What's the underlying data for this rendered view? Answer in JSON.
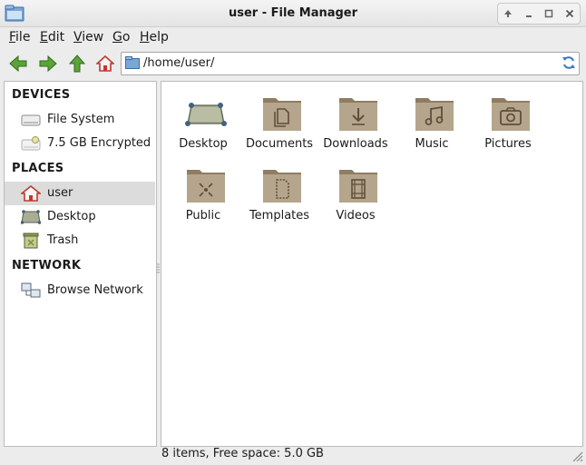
{
  "window": {
    "title": "user - File Manager"
  },
  "menu": [
    {
      "label": "File",
      "u": "F",
      "rest": "ile"
    },
    {
      "label": "Edit",
      "u": "E",
      "rest": "dit"
    },
    {
      "label": "View",
      "u": "V",
      "rest": "iew"
    },
    {
      "label": "Go",
      "u": "G",
      "rest": "o"
    },
    {
      "label": "Help",
      "u": "H",
      "rest": "elp"
    }
  ],
  "location": {
    "path": "/home/user/"
  },
  "sidebar": {
    "devices_header": "DEVICES",
    "places_header": "PLACES",
    "network_header": "NETWORK",
    "devices": [
      {
        "label": "File System",
        "icon": "drive-icon"
      },
      {
        "label": "7.5 GB Encrypted",
        "icon": "encrypted-drive-icon"
      }
    ],
    "places": [
      {
        "label": "user",
        "icon": "home-icon",
        "selected": true
      },
      {
        "label": "Desktop",
        "icon": "desktop-icon"
      },
      {
        "label": "Trash",
        "icon": "trash-icon"
      }
    ],
    "network": [
      {
        "label": "Browse Network",
        "icon": "network-icon"
      }
    ]
  },
  "files": [
    {
      "name": "Desktop",
      "icon": "desktop-folder-icon"
    },
    {
      "name": "Documents",
      "icon": "documents-folder-icon"
    },
    {
      "name": "Downloads",
      "icon": "downloads-folder-icon"
    },
    {
      "name": "Music",
      "icon": "music-folder-icon"
    },
    {
      "name": "Pictures",
      "icon": "pictures-folder-icon"
    },
    {
      "name": "Public",
      "icon": "public-folder-icon"
    },
    {
      "name": "Templates",
      "icon": "templates-folder-icon"
    },
    {
      "name": "Videos",
      "icon": "videos-folder-icon"
    }
  ],
  "status": {
    "text": "8 items, Free space: 5.0 GB"
  },
  "colors": {
    "folder": "#b5a58c",
    "folder_dark": "#8e7d63",
    "nav_green": "#5aa43a",
    "selection": "#dcdcdc"
  }
}
